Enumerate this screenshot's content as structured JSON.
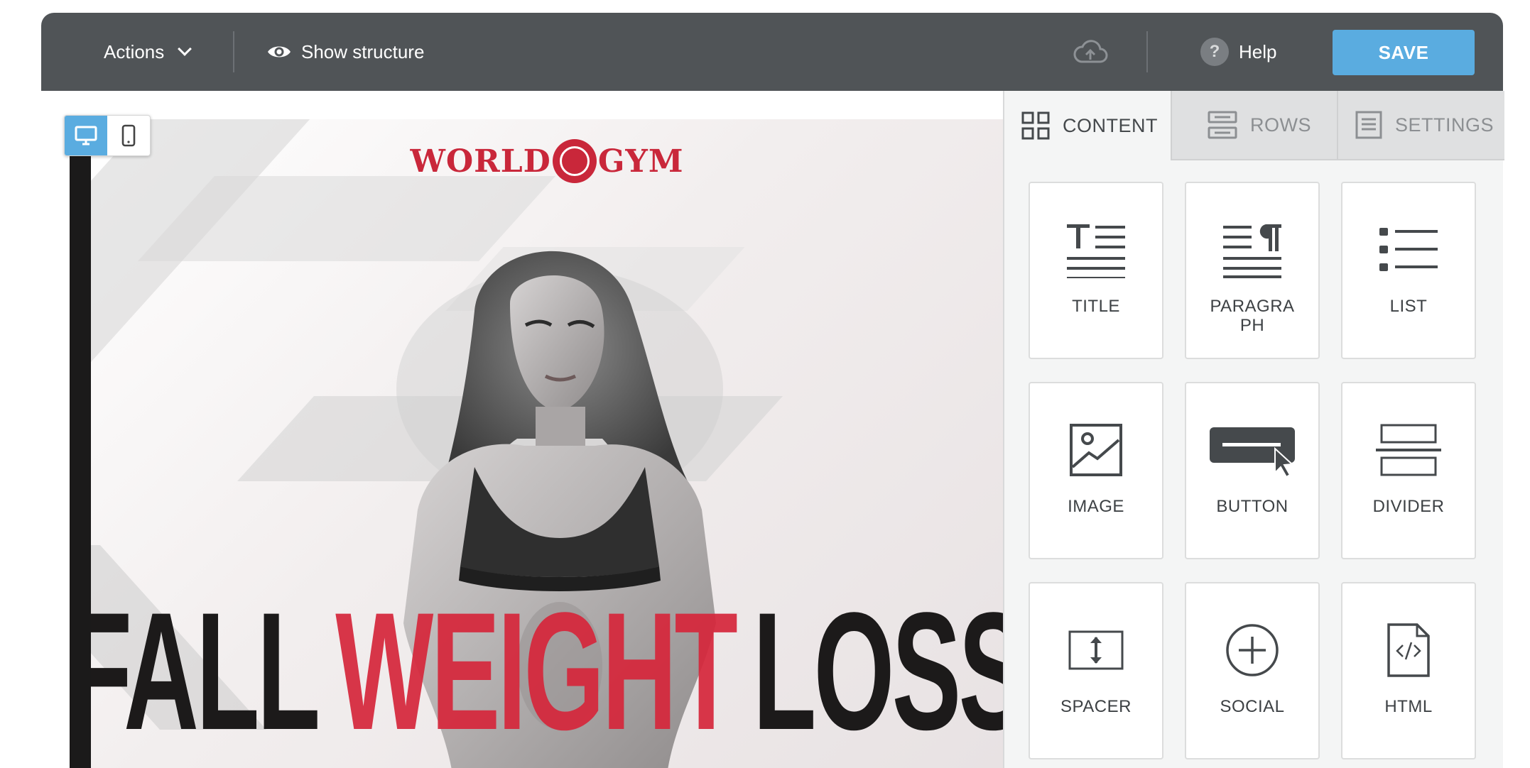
{
  "toolbar": {
    "actions_label": "Actions",
    "show_structure_label": "Show structure",
    "help_label": "Help",
    "help_icon_glyph": "?",
    "save_label": "SAVE",
    "bg_color": "#505457",
    "save_color": "#5aace0"
  },
  "canvas": {
    "device_modes": [
      "desktop",
      "mobile"
    ],
    "active_device": "desktop",
    "email": {
      "logo_left": "WORLD",
      "logo_right": "GYM",
      "headline": [
        "FALL",
        "WEIGHT",
        "LOSS"
      ],
      "accent_color": "#d5273c"
    }
  },
  "panel": {
    "tabs": [
      {
        "label": "CONTENT",
        "icon": "grid-icon",
        "active": true
      },
      {
        "label": "ROWS",
        "icon": "rows-icon",
        "active": false
      },
      {
        "label": "SETTINGS",
        "icon": "settings-doc-icon",
        "active": false
      }
    ],
    "blocks": [
      {
        "label": "TITLE",
        "icon": "title-icon"
      },
      {
        "label": "PARAGRA\nPH",
        "icon": "paragraph-icon"
      },
      {
        "label": "LIST",
        "icon": "list-icon"
      },
      {
        "label": "IMAGE",
        "icon": "image-icon"
      },
      {
        "label": "BUTTON",
        "icon": "button-icon"
      },
      {
        "label": "DIVIDER",
        "icon": "divider-icon"
      },
      {
        "label": "SPACER",
        "icon": "spacer-icon"
      },
      {
        "label": "SOCIAL",
        "icon": "social-icon"
      },
      {
        "label": "HTML",
        "icon": "html-icon"
      }
    ]
  }
}
